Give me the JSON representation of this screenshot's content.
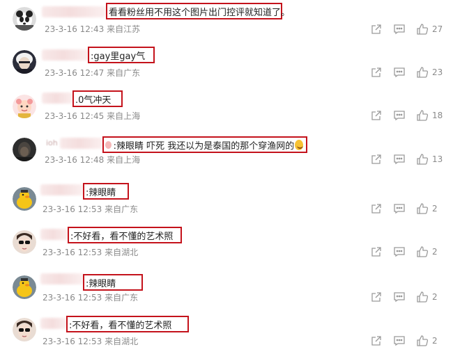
{
  "comments": [
    {
      "content": "看看粉丝用不用这个图片出门控评就知道了。",
      "date": "23-3-16 12:43",
      "source": "来自江苏",
      "likes": "27",
      "avatar": "panda"
    },
    {
      "content": ":gay里gay气",
      "date": "23-3-16 12:47",
      "source": "来自广东",
      "likes": "23",
      "avatar": "gojo"
    },
    {
      "content": ".0气冲天",
      "date": "23-3-16 12:45",
      "source": "来自上海",
      "likes": "18",
      "avatar": "cartoon"
    },
    {
      "content": ":辣眼睛 吓死 我还以为是泰国的那个穿渔网的",
      "date": "23-3-16 12:48",
      "source": "来自上海",
      "likes": "13",
      "avatar": "dark"
    },
    {
      "content": ":辣眼睛",
      "date": "23-3-16 12:53",
      "source": "来自广东",
      "likes": "2",
      "avatar": "duck"
    },
    {
      "content": ":不好看，看不懂的艺术照",
      "date": "23-3-16 12:53",
      "source": "来自湖北",
      "likes": "2",
      "avatar": "sunglasses"
    },
    {
      "content": ":辣眼睛",
      "date": "23-3-16 12:53",
      "source": "来自广东",
      "likes": "2",
      "avatar": "duck"
    },
    {
      "content": ":不好看，看不懂的艺术照",
      "date": "23-3-16 12:53",
      "source": "来自湖北",
      "likes": "2",
      "avatar": "sunglasses"
    }
  ],
  "icons": {
    "share": "share-icon",
    "comment": "comment-icon",
    "like": "thumbs-up-icon"
  },
  "colors": {
    "highlight_border": "#c4121b",
    "meta_text": "#8a8a8a"
  }
}
